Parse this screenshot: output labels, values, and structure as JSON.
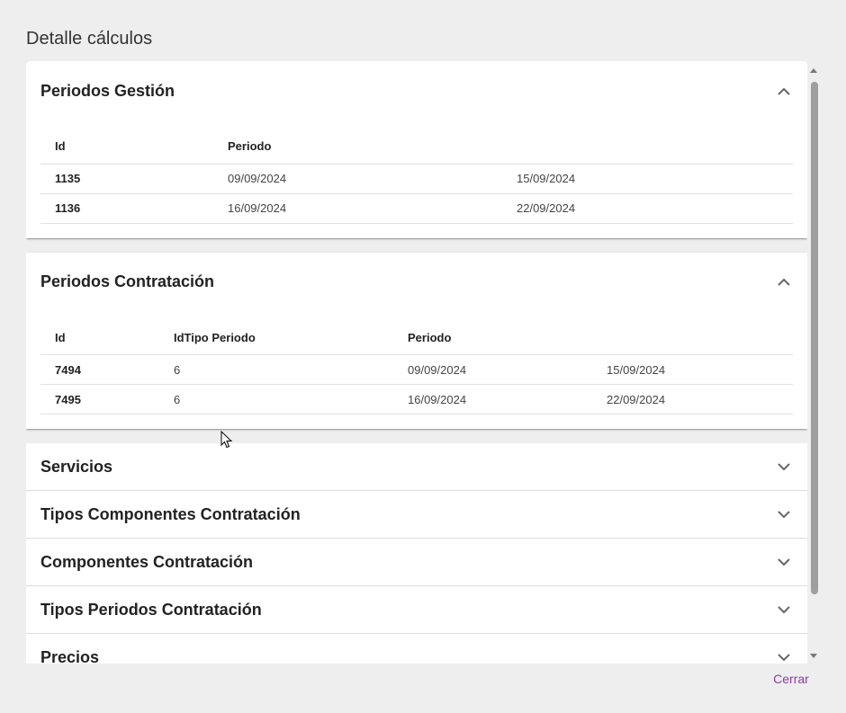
{
  "dialog": {
    "title": "Detalle cálculos",
    "close_label": "Cerrar"
  },
  "periodos_gestion": {
    "title": "Periodos Gestión",
    "headers": [
      "Id",
      "Periodo",
      ""
    ],
    "rows": [
      [
        "1135",
        "09/09/2024",
        "15/09/2024"
      ],
      [
        "1136",
        "16/09/2024",
        "22/09/2024"
      ]
    ]
  },
  "periodos_contratacion": {
    "title": "Periodos Contratación",
    "headers": [
      "Id",
      "IdTipo Periodo",
      "Periodo",
      ""
    ],
    "rows": [
      [
        "7494",
        "6",
        "09/09/2024",
        "15/09/2024"
      ],
      [
        "7495",
        "6",
        "16/09/2024",
        "22/09/2024"
      ]
    ]
  },
  "collapsed_panels": [
    "Servicios",
    "Tipos Componentes Contratación",
    "Componentes Contratación",
    "Tipos Periodos Contratación",
    "Precios"
  ],
  "icons": {
    "expanded": "chevron-up-icon",
    "collapsed": "chevron-down-icon"
  },
  "colors": {
    "accent": "#8e3aa6",
    "background": "#eeeeee"
  }
}
